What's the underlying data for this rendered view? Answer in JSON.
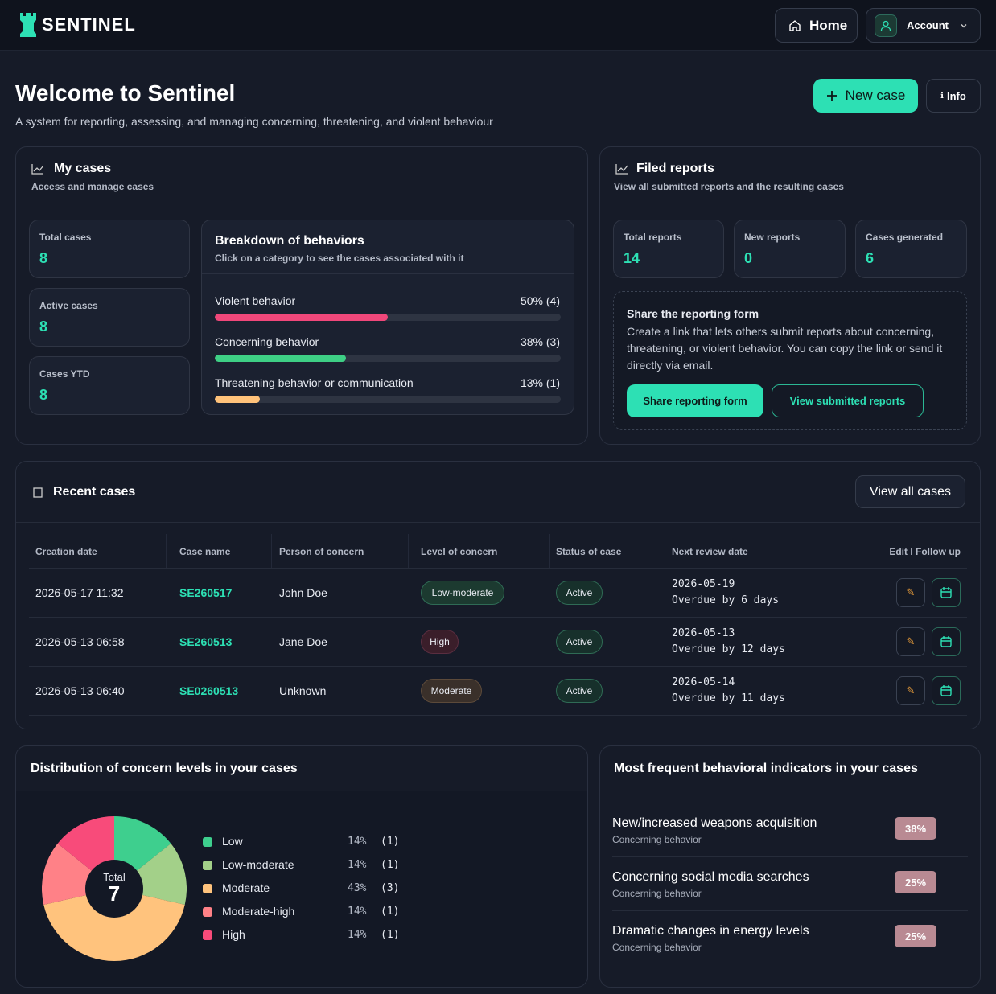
{
  "app": {
    "name": "SENTINEL"
  },
  "nav": {
    "home_label": "Home",
    "account_label": "Account"
  },
  "header": {
    "title": "Welcome to Sentinel",
    "subtitle": "A system for reporting, assessing, and managing concerning, threatening, and violent behaviour",
    "new_case_label": "New case",
    "info_label": "Info"
  },
  "my_cases": {
    "title": "My cases",
    "subtitle": "Access and manage cases",
    "stats": [
      {
        "label": "Total cases",
        "value": "8"
      },
      {
        "label": "Active cases",
        "value": "8"
      },
      {
        "label": "Cases YTD",
        "value": "8"
      }
    ],
    "breakdown": {
      "title": "Breakdown of behaviors",
      "subtitle": "Click on a category to see the cases associated with it",
      "items": [
        {
          "label": "Violent behavior",
          "value": "50% (4)",
          "percent": 50,
          "color": "#f0477a"
        },
        {
          "label": "Concerning behavior",
          "value": "38% (3)",
          "percent": 38,
          "color": "#3ecf85"
        },
        {
          "label": "Threatening behavior or communication",
          "value": "13% (1)",
          "percent": 13,
          "color": "#ffc27a"
        }
      ]
    }
  },
  "filed_reports": {
    "title": "Filed reports",
    "subtitle": "View all submitted reports and the resulting cases",
    "stats": [
      {
        "label": "Total reports",
        "value": "14"
      },
      {
        "label": "New reports",
        "value": "0"
      },
      {
        "label": "Cases generated",
        "value": "6"
      }
    ],
    "share": {
      "title": "Share the reporting form",
      "text": "Create a link that lets others submit reports about concerning, threatening, or violent behavior. You can copy the link or send it directly via email.",
      "share_button": "Share reporting form",
      "view_button": "View submitted reports"
    }
  },
  "recent_cases": {
    "title": "Recent cases",
    "view_all_label": "View all cases",
    "columns": [
      "Creation date",
      "Case name",
      "Person of concern",
      "Level of concern",
      "Status of case",
      "Next review date",
      "Edit I Follow up"
    ],
    "rows": [
      {
        "created": "2026-05-17 11:32",
        "case": "SE260517",
        "person": "John Doe",
        "level": "Low-moderate",
        "level_color": "#1c3a30",
        "level_border": "#2f6b55",
        "status": "Active",
        "review_date": "2026-05-19",
        "overdue": "Overdue by 6 days"
      },
      {
        "created": "2026-05-13 06:58",
        "case": "SE260513",
        "person": "Jane Doe",
        "level": "High",
        "level_color": "#3a1e2a",
        "level_border": "#5a2e40",
        "status": "Active",
        "review_date": "2026-05-13",
        "overdue": "Overdue by 12 days"
      },
      {
        "created": "2026-05-13 06:40",
        "case": "SE0260513",
        "person": "Unknown",
        "level": "Moderate",
        "level_color": "#3a302a",
        "level_border": "#5c4a3a",
        "status": "Active",
        "review_date": "2026-05-14",
        "overdue": "Overdue by 11 days"
      }
    ]
  },
  "distribution": {
    "title": "Distribution of concern levels in your cases",
    "total_label": "Total",
    "total_value": "7",
    "legend": [
      {
        "name": "Low",
        "pct": "14%",
        "count": "(1)",
        "color": "#3ecf8e"
      },
      {
        "name": "Low-moderate",
        "pct": "14%",
        "count": "(1)",
        "color": "#a3d089"
      },
      {
        "name": "Moderate",
        "pct": "43%",
        "count": "(3)",
        "color": "#ffc37d"
      },
      {
        "name": "Moderate-high",
        "pct": "14%",
        "count": "(1)",
        "color": "#ff8187"
      },
      {
        "name": "High",
        "pct": "14%",
        "count": "(1)",
        "color": "#f84b7a"
      }
    ]
  },
  "chart_data": {
    "type": "pie",
    "categories": [
      "Low",
      "Low-moderate",
      "Moderate",
      "Moderate-high",
      "High"
    ],
    "values": [
      1,
      1,
      3,
      1,
      1
    ],
    "colors": [
      "#3ecf8e",
      "#a3d089",
      "#ffc37d",
      "#ff8187",
      "#f84b7a"
    ],
    "title": "Distribution of concern levels in your cases"
  },
  "indicators": {
    "title": "Most frequent behavioral indicators in your cases",
    "items": [
      {
        "name": "New/increased weapons acquisition",
        "category": "Concerning behavior",
        "pct": "38%"
      },
      {
        "name": "Concerning social media searches",
        "category": "Concerning behavior",
        "pct": "25%"
      },
      {
        "name": "Dramatic changes in energy levels",
        "category": "Concerning behavior",
        "pct": "25%"
      }
    ]
  }
}
